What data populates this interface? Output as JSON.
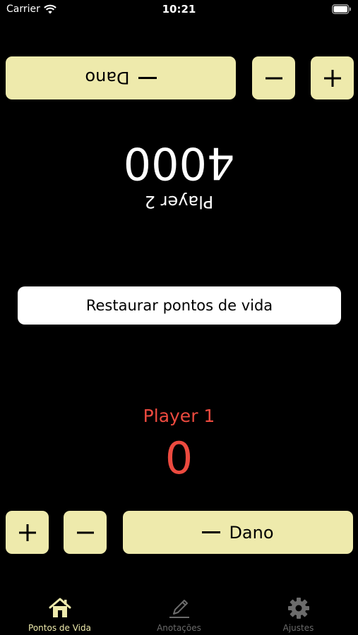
{
  "status_bar": {
    "carrier": "Carrier",
    "time": "10:21"
  },
  "player2": {
    "name": "Player 2",
    "life": "4000",
    "dano_label": "Dano",
    "color": "#ffffff"
  },
  "restore": {
    "label": "Restaurar pontos de vida"
  },
  "player1": {
    "name": "Player 1",
    "life": "0",
    "dano_label": "Dano",
    "color": "#ec4a3f"
  },
  "colors": {
    "button_bg": "#eeeaac",
    "background": "#000000",
    "tab_active": "#eeeaac",
    "tab_inactive": "#6b6b6b"
  },
  "tab_bar": {
    "tabs": [
      {
        "label": "Pontos de Vida",
        "icon": "house-icon",
        "active": true
      },
      {
        "label": "Anotações",
        "icon": "pencil-icon",
        "active": false
      },
      {
        "label": "Ajustes",
        "icon": "gear-icon",
        "active": false
      }
    ]
  }
}
